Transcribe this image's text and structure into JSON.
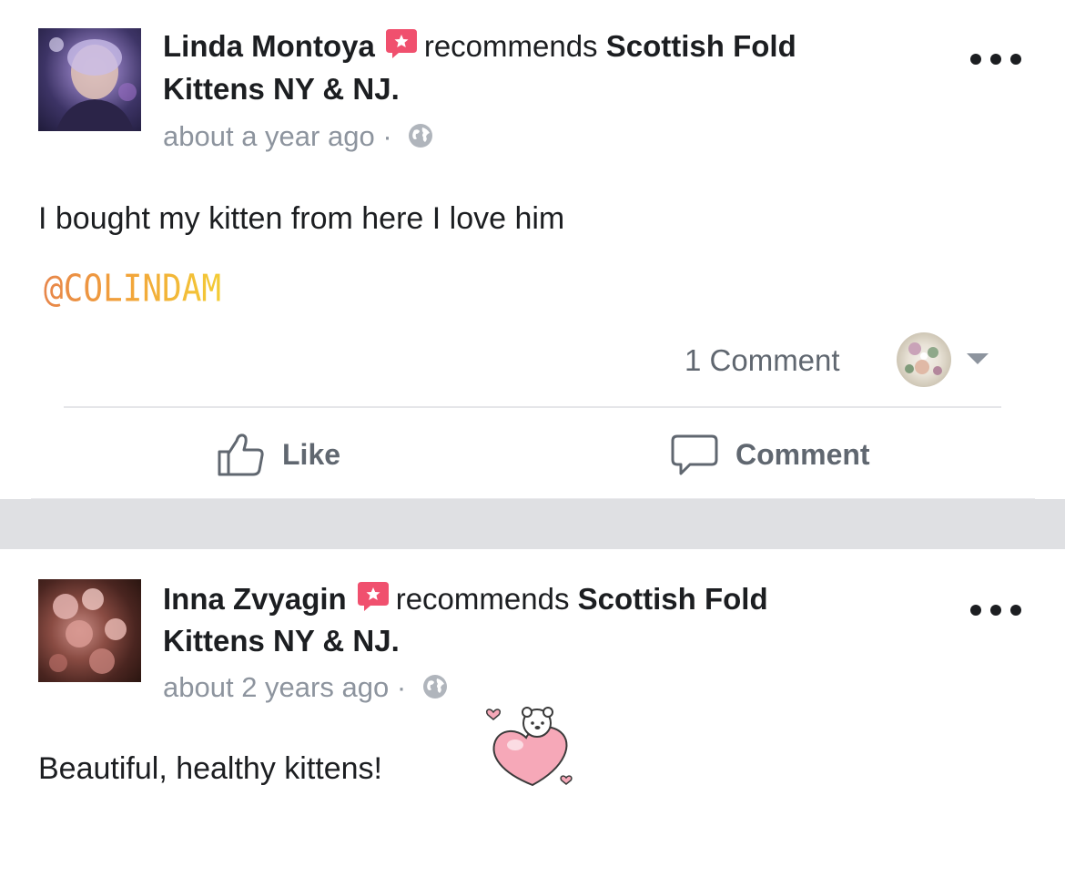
{
  "posts": [
    {
      "author": "Linda Montoya",
      "recommends_text": "recommends",
      "page_part1": "Scottish Fold",
      "page_part2": "Kittens NY & NJ.",
      "timestamp": "about a year ago",
      "meta_separator": "·",
      "privacy_icon": "globe-icon",
      "body": "I bought my kitten from here I love him",
      "mention": "@COLINDAM",
      "comment_count": "1 Comment",
      "actions": {
        "like": "Like",
        "comment": "Comment"
      }
    },
    {
      "author": "Inna Zvyagin",
      "recommends_text": "recommends",
      "page_part1": "Scottish Fold",
      "page_part2": "Kittens NY & NJ.",
      "timestamp": "about 2 years ago",
      "meta_separator": "·",
      "privacy_icon": "globe-icon",
      "body": "Beautiful, healthy kittens!"
    }
  ],
  "colors": {
    "recommend_badge": "#f0506e",
    "secondary_text": "#8d949e",
    "action_text": "#606770",
    "separator": "#dfe0e3"
  }
}
